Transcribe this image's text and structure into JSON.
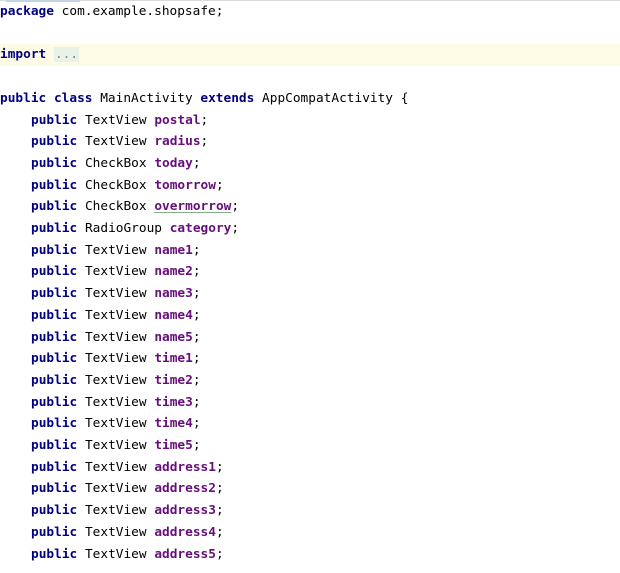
{
  "editor": {
    "package_line": {
      "keyword": "package",
      "name": "com.example.shopsafe;"
    },
    "import_line": {
      "keyword": "import",
      "fold": "..."
    },
    "class_line": {
      "kw_public": "public",
      "kw_class": "class",
      "class_name": "MainActivity",
      "kw_extends": "extends",
      "super_name": "AppCompatActivity",
      "brace": "{"
    },
    "fields": [
      {
        "mod": "public",
        "type": "TextView",
        "name": "postal",
        "end": ";"
      },
      {
        "mod": "public",
        "type": "TextView",
        "name": "radius",
        "end": ";"
      },
      {
        "mod": "public",
        "type": "CheckBox",
        "name": "today",
        "end": ";"
      },
      {
        "mod": "public",
        "type": "CheckBox",
        "name": "tomorrow",
        "end": ";"
      },
      {
        "mod": "public",
        "type": "CheckBox",
        "name": "overmorrow",
        "end": ";"
      },
      {
        "mod": "public",
        "type": "RadioGroup",
        "name": "category",
        "end": ";"
      },
      {
        "mod": "public",
        "type": "TextView",
        "name": "name1",
        "end": ";"
      },
      {
        "mod": "public",
        "type": "TextView",
        "name": "name2",
        "end": ";"
      },
      {
        "mod": "public",
        "type": "TextView",
        "name": "name3",
        "end": ";"
      },
      {
        "mod": "public",
        "type": "TextView",
        "name": "name4",
        "end": ";"
      },
      {
        "mod": "public",
        "type": "TextView",
        "name": "name5",
        "end": ";"
      },
      {
        "mod": "public",
        "type": "TextView",
        "name": "time1",
        "end": ";"
      },
      {
        "mod": "public",
        "type": "TextView",
        "name": "time2",
        "end": ";"
      },
      {
        "mod": "public",
        "type": "TextView",
        "name": "time3",
        "end": ";"
      },
      {
        "mod": "public",
        "type": "TextView",
        "name": "time4",
        "end": ";"
      },
      {
        "mod": "public",
        "type": "TextView",
        "name": "time5",
        "end": ";"
      },
      {
        "mod": "public",
        "type": "TextView",
        "name": "address1",
        "end": ";"
      },
      {
        "mod": "public",
        "type": "TextView",
        "name": "address2",
        "end": ";"
      },
      {
        "mod": "public",
        "type": "TextView",
        "name": "address3",
        "end": ";"
      },
      {
        "mod": "public",
        "type": "TextView",
        "name": "address4",
        "end": ";"
      },
      {
        "mod": "public",
        "type": "TextView",
        "name": "address5",
        "end": ";"
      }
    ],
    "colors": {
      "keyword": "#000080",
      "field": "#660e7a",
      "highlight_line": "#fdfbe6",
      "fold_bg": "#e8f2e6"
    }
  }
}
